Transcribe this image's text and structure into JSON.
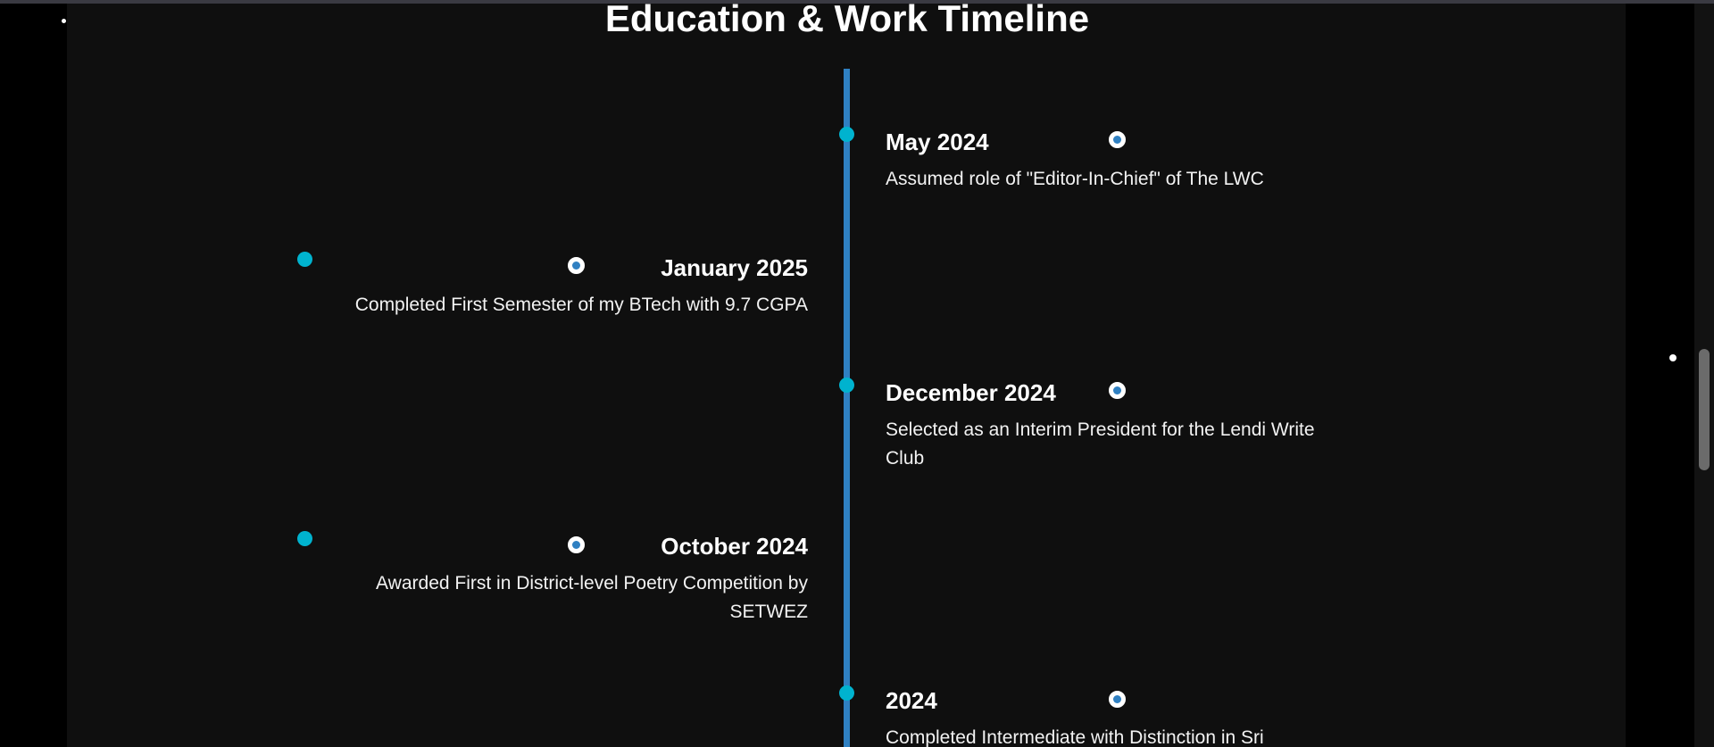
{
  "page": {
    "title": "Education & Work Timeline"
  },
  "timeline": {
    "entries": [
      {
        "side": "right",
        "date": "May 2024",
        "description": "Assumed role of \"Editor-In-Chief\" of The LWC"
      },
      {
        "side": "left",
        "date": "January 2025",
        "description": "Completed First Semester of my BTech with 9.7 CGPA"
      },
      {
        "side": "right",
        "date": "December 2024",
        "description": "Selected as an Interim President for the Lendi Write Club"
      },
      {
        "side": "left",
        "date": "October 2024",
        "description": "Awarded First in District-level Poetry Competition by SETWEZ"
      },
      {
        "side": "right",
        "date": "2024",
        "description": "Completed Intermediate with Distinction in Sri"
      }
    ]
  },
  "colors": {
    "background": "#0f0f0f",
    "timeline_line": "#2f80c2",
    "dot": "#00b3cf",
    "text": "#ffffff"
  },
  "icons": {
    "entry_marker": "ring-icon"
  }
}
